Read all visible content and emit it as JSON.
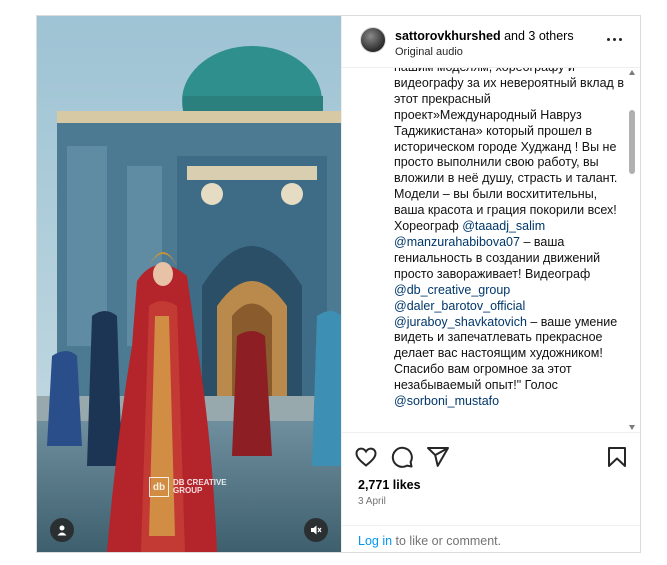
{
  "post": {
    "username": "sattorovkhurshed",
    "coauthors_text": "and 3 others",
    "audio": "Original audio",
    "watermark": {
      "logo": "db",
      "line1": "DB CREATIVE",
      "line2": "GROUP"
    },
    "caption": [
      {
        "type": "text",
        "value": "нашим моделям, хореографу и видеографу за их невероятный вклад в этот прекрасный проект»Международный Навруз Таджикистана» который прошел в историческом городе Худжанд ! Вы не просто выполнили свою работу, вы вложили в неё душу, страсть и талант."
      },
      {
        "type": "text",
        "value": " Модели – вы были восхитительны, ваша красота и грация покорили всех! Хореограф "
      },
      {
        "type": "mention",
        "value": "@taaadj_salim"
      },
      {
        "type": "text",
        "value": " "
      },
      {
        "type": "mention",
        "value": "@manzurahabibova07"
      },
      {
        "type": "text",
        "value": " – ваша гениальность в создании движений просто завораживает! Видеограф "
      },
      {
        "type": "mention",
        "value": "@db_creative_group"
      },
      {
        "type": "text",
        "value": " "
      },
      {
        "type": "mention",
        "value": "@daler_barotov_official"
      },
      {
        "type": "text",
        "value": " "
      },
      {
        "type": "mention",
        "value": "@juraboy_shavkatovich"
      },
      {
        "type": "text",
        "value": " – ваше умение видеть и запечатлевать прекрасное делает вас настоящим художником!"
      },
      {
        "type": "text",
        "value": " Спасибо вам огромное за этот незабываемый опыт!\" Голос "
      },
      {
        "type": "mention",
        "value": "@sorboni_mustafo"
      }
    ],
    "likes": "2,771 likes",
    "date": "3 April",
    "login_link": "Log in",
    "login_rest": " to like or comment."
  },
  "icons": [
    "more-options-icon",
    "heart-icon",
    "comment-icon",
    "share-icon",
    "bookmark-icon",
    "user-tag-icon",
    "mute-icon"
  ],
  "colors": {
    "link": "#0095f6",
    "mention": "#00376b",
    "muted": "#737373",
    "border": "#dbdbdb"
  }
}
